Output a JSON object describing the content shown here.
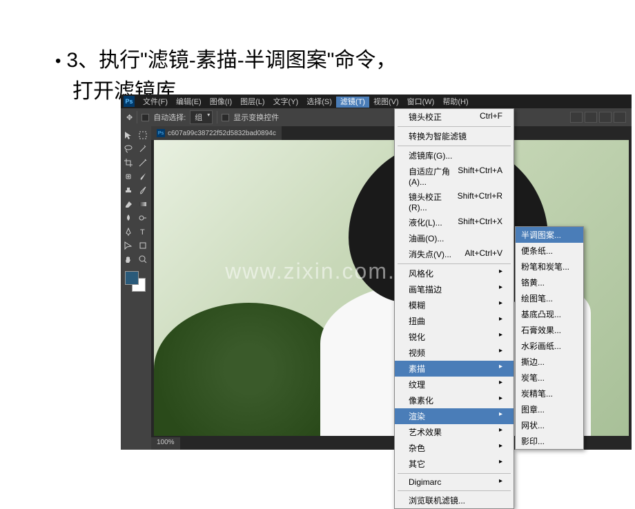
{
  "slide": {
    "bullet": "•",
    "line1": "3、执行\"滤镜-素描-半调图案\"命令，",
    "line2": "打开滤镜库"
  },
  "menubar": {
    "logo": "Ps",
    "items": [
      "文件(F)",
      "编辑(E)",
      "图像(I)",
      "图层(L)",
      "文字(Y)",
      "选择(S)",
      "滤镜(T)",
      "视图(V)",
      "窗口(W)",
      "帮助(H)"
    ],
    "active_index": 6
  },
  "optbar": {
    "move_icon": "✥",
    "auto_select": "自动选择:",
    "group": "组",
    "show_transform": "显示变换控件"
  },
  "doc": {
    "tab": "c607a99c38722f52d5832bad0894c",
    "zoom": "100%"
  },
  "filter_menu": {
    "items": [
      {
        "label": "镜头校正",
        "shortcut": "Ctrl+F"
      },
      {
        "sep": true
      },
      {
        "label": "转换为智能滤镜"
      },
      {
        "sep": true
      },
      {
        "label": "滤镜库(G)..."
      },
      {
        "label": "自适应广角(A)...",
        "shortcut": "Shift+Ctrl+A"
      },
      {
        "label": "镜头校正(R)...",
        "shortcut": "Shift+Ctrl+R"
      },
      {
        "label": "液化(L)...",
        "shortcut": "Shift+Ctrl+X"
      },
      {
        "label": "油画(O)..."
      },
      {
        "label": "消失点(V)...",
        "shortcut": "Alt+Ctrl+V"
      },
      {
        "sep": true
      },
      {
        "label": "风格化",
        "arrow": true
      },
      {
        "label": "画笔描边",
        "arrow": true
      },
      {
        "label": "模糊",
        "arrow": true
      },
      {
        "label": "扭曲",
        "arrow": true
      },
      {
        "label": "锐化",
        "arrow": true
      },
      {
        "label": "视频",
        "arrow": true
      },
      {
        "label": "素描",
        "arrow": true,
        "hl": true
      },
      {
        "label": "纹理",
        "arrow": true
      },
      {
        "label": "像素化",
        "arrow": true
      },
      {
        "label": "渲染",
        "arrow": true,
        "hl": true
      },
      {
        "label": "艺术效果",
        "arrow": true
      },
      {
        "label": "杂色",
        "arrow": true
      },
      {
        "label": "其它",
        "arrow": true
      },
      {
        "sep": true
      },
      {
        "label": "Digimarc",
        "arrow": true
      },
      {
        "sep": true
      },
      {
        "label": "浏览联机滤镜..."
      }
    ]
  },
  "submenu": {
    "items": [
      {
        "label": "半调图案...",
        "hl": true
      },
      {
        "label": "便条纸..."
      },
      {
        "label": "粉笔和炭笔..."
      },
      {
        "label": "铬黄..."
      },
      {
        "label": "绘图笔..."
      },
      {
        "label": "基底凸现..."
      },
      {
        "label": "石膏效果..."
      },
      {
        "label": "水彩画纸..."
      },
      {
        "label": "撕边..."
      },
      {
        "label": "炭笔..."
      },
      {
        "label": "炭精笔..."
      },
      {
        "label": "图章..."
      },
      {
        "label": "网状..."
      },
      {
        "label": "影印..."
      }
    ]
  },
  "watermark": "www.zixin.com.cn"
}
